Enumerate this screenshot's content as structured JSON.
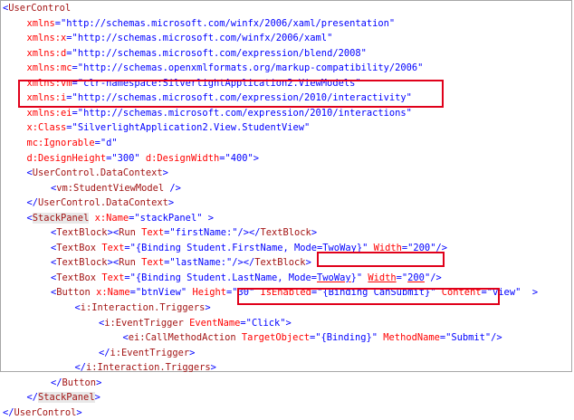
{
  "lines": [
    {
      "indent": 0,
      "segments": [
        {
          "c": "br",
          "t": "<"
        },
        {
          "c": "tag",
          "t": "UserControl"
        }
      ]
    },
    {
      "indent": 1,
      "segments": [
        {
          "c": "attr",
          "t": "xmlns"
        },
        {
          "c": "br",
          "t": "=\""
        },
        {
          "c": "val",
          "t": "http://schemas.microsoft.com/winfx/2006/xaml/presentation"
        },
        {
          "c": "br",
          "t": "\""
        }
      ]
    },
    {
      "indent": 1,
      "segments": [
        {
          "c": "attr",
          "t": "xmlns:x"
        },
        {
          "c": "br",
          "t": "=\""
        },
        {
          "c": "val",
          "t": "http://schemas.microsoft.com/winfx/2006/xaml"
        },
        {
          "c": "br",
          "t": "\""
        }
      ]
    },
    {
      "indent": 1,
      "segments": [
        {
          "c": "attr",
          "t": "xmlns:d"
        },
        {
          "c": "br",
          "t": "=\""
        },
        {
          "c": "val",
          "t": "http://schemas.microsoft.com/expression/blend/2008"
        },
        {
          "c": "br",
          "t": "\""
        }
      ]
    },
    {
      "indent": 1,
      "segments": [
        {
          "c": "attr",
          "t": "xmlns:mc"
        },
        {
          "c": "br",
          "t": "=\""
        },
        {
          "c": "val",
          "t": "http://schemas.openxmlformats.org/markup-compatibility/2006"
        },
        {
          "c": "br",
          "t": "\""
        }
      ]
    },
    {
      "indent": 1,
      "segments": [
        {
          "c": "attr",
          "t": "xmlns:vm"
        },
        {
          "c": "br",
          "t": "=\""
        },
        {
          "c": "val",
          "t": "clr-namespace:SilverlightApplication2.ViewModels"
        },
        {
          "c": "br",
          "t": "\""
        }
      ]
    },
    {
      "indent": 1,
      "segments": [
        {
          "c": "attr",
          "t": "xmlns:i"
        },
        {
          "c": "br",
          "t": "=\""
        },
        {
          "c": "val",
          "t": "http://schemas.microsoft.com/expression/2010/interactivity"
        },
        {
          "c": "br",
          "t": "\""
        }
      ]
    },
    {
      "indent": 1,
      "segments": [
        {
          "c": "attr",
          "t": "xmlns:ei"
        },
        {
          "c": "br",
          "t": "=\""
        },
        {
          "c": "val",
          "t": "http://schemas.microsoft.com/expression/2010/interactions"
        },
        {
          "c": "br",
          "t": "\""
        }
      ]
    },
    {
      "indent": 1,
      "segments": [
        {
          "c": "attr",
          "t": "x:Class"
        },
        {
          "c": "br",
          "t": "=\""
        },
        {
          "c": "val",
          "t": "SilverlightApplication2.View.StudentView"
        },
        {
          "c": "br",
          "t": "\""
        }
      ]
    },
    {
      "indent": 1,
      "segments": [
        {
          "c": "attr",
          "t": "mc:Ignorable"
        },
        {
          "c": "br",
          "t": "=\""
        },
        {
          "c": "val",
          "t": "d"
        },
        {
          "c": "br",
          "t": "\""
        }
      ]
    },
    {
      "indent": 1,
      "segments": [
        {
          "c": "attr",
          "t": "d:DesignHeight"
        },
        {
          "c": "br",
          "t": "=\""
        },
        {
          "c": "val",
          "t": "300"
        },
        {
          "c": "br",
          "t": "\" "
        },
        {
          "c": "attr",
          "t": "d:DesignWidth"
        },
        {
          "c": "br",
          "t": "=\""
        },
        {
          "c": "val",
          "t": "400"
        },
        {
          "c": "br",
          "t": "\">"
        }
      ]
    },
    {
      "indent": 1,
      "segments": [
        {
          "c": "br",
          "t": "<"
        },
        {
          "c": "tag",
          "t": "UserControl.DataContext"
        },
        {
          "c": "br",
          "t": ">"
        }
      ]
    },
    {
      "indent": 2,
      "segments": [
        {
          "c": "br",
          "t": "<"
        },
        {
          "c": "tag",
          "t": "vm:StudentViewModel"
        },
        {
          "c": "br",
          "t": " />"
        }
      ]
    },
    {
      "indent": 1,
      "segments": [
        {
          "c": "br",
          "t": "</"
        },
        {
          "c": "tag",
          "t": "UserControl.DataContext"
        },
        {
          "c": "br",
          "t": ">"
        }
      ]
    },
    {
      "indent": 1,
      "segments": [
        {
          "c": "br",
          "t": "<"
        },
        {
          "c": "tag hl-bg",
          "t": "StackPanel"
        },
        {
          "c": "attr",
          "t": " x:Name"
        },
        {
          "c": "br",
          "t": "=\""
        },
        {
          "c": "val",
          "t": "stackPanel"
        },
        {
          "c": "br",
          "t": "\" >"
        }
      ]
    },
    {
      "indent": 2,
      "segments": [
        {
          "c": "br",
          "t": "<"
        },
        {
          "c": "tag",
          "t": "TextBlock"
        },
        {
          "c": "br",
          "t": "><"
        },
        {
          "c": "tag",
          "t": "Run"
        },
        {
          "c": "attr",
          "t": " Text"
        },
        {
          "c": "br",
          "t": "=\""
        },
        {
          "c": "val",
          "t": "firstName:"
        },
        {
          "c": "br",
          "t": "\"/></"
        },
        {
          "c": "tag",
          "t": "TextBlock"
        },
        {
          "c": "br",
          "t": ">"
        }
      ]
    },
    {
      "indent": 2,
      "segments": [
        {
          "c": "br",
          "t": "<"
        },
        {
          "c": "tag",
          "t": "TextBox"
        },
        {
          "c": "attr",
          "t": " Text"
        },
        {
          "c": "br",
          "t": "=\""
        },
        {
          "c": "val",
          "t": "{Binding Student.FirstName, Mode=TwoWay}"
        },
        {
          "c": "br",
          "t": "\" "
        },
        {
          "c": "attr",
          "t": "Width"
        },
        {
          "c": "br",
          "t": "=\""
        },
        {
          "c": "val",
          "t": "200"
        },
        {
          "c": "br",
          "t": "\"/>"
        }
      ]
    },
    {
      "indent": 2,
      "segments": [
        {
          "c": "br",
          "t": "<"
        },
        {
          "c": "tag",
          "t": "TextBlock"
        },
        {
          "c": "br",
          "t": "><"
        },
        {
          "c": "tag",
          "t": "Run"
        },
        {
          "c": "attr",
          "t": " Text"
        },
        {
          "c": "br",
          "t": "=\""
        },
        {
          "c": "val",
          "t": "lastName:"
        },
        {
          "c": "br",
          "t": "\"/></"
        },
        {
          "c": "tag",
          "t": "TextBlock"
        },
        {
          "c": "br",
          "t": ">"
        }
      ]
    },
    {
      "indent": 2,
      "segments": [
        {
          "c": "br",
          "t": "<"
        },
        {
          "c": "tag",
          "t": "TextBox"
        },
        {
          "c": "attr",
          "t": " Text"
        },
        {
          "c": "br",
          "t": "=\""
        },
        {
          "c": "val",
          "t": "{Binding Student.LastName, Mode="
        },
        {
          "c": "val underline-red",
          "t": "TwoWay"
        },
        {
          "c": "val",
          "t": "}"
        },
        {
          "c": "br",
          "t": "\" "
        },
        {
          "c": "attr underline-red",
          "t": "Width"
        },
        {
          "c": "br",
          "t": "=\""
        },
        {
          "c": "val underline-red",
          "t": "200"
        },
        {
          "c": "br",
          "t": "\"/>"
        }
      ]
    },
    {
      "indent": 2,
      "segments": [
        {
          "c": "br",
          "t": "<"
        },
        {
          "c": "tag",
          "t": "Button"
        },
        {
          "c": "attr",
          "t": " x:Name"
        },
        {
          "c": "br",
          "t": "=\""
        },
        {
          "c": "val",
          "t": "btnView"
        },
        {
          "c": "br",
          "t": "\" "
        },
        {
          "c": "attr",
          "t": "Height"
        },
        {
          "c": "br",
          "t": "=\""
        },
        {
          "c": "val",
          "t": "30"
        },
        {
          "c": "br",
          "t": "\" "
        },
        {
          "c": "attr",
          "t": "IsEnabled"
        },
        {
          "c": "br",
          "t": "=\""
        },
        {
          "c": "val",
          "t": "{Binding CanSubmit}"
        },
        {
          "c": "br",
          "t": "\" "
        },
        {
          "c": "attr",
          "t": "Content"
        },
        {
          "c": "br",
          "t": "=\""
        },
        {
          "c": "val",
          "t": "view"
        },
        {
          "c": "br",
          "t": "\"  >"
        }
      ]
    },
    {
      "indent": 3,
      "segments": [
        {
          "c": "br",
          "t": "<"
        },
        {
          "c": "tag",
          "t": "i:Interaction.Triggers"
        },
        {
          "c": "br",
          "t": ">"
        }
      ]
    },
    {
      "indent": 4,
      "segments": [
        {
          "c": "br",
          "t": "<"
        },
        {
          "c": "tag",
          "t": "i:EventTrigger"
        },
        {
          "c": "attr",
          "t": " EventName"
        },
        {
          "c": "br",
          "t": "=\""
        },
        {
          "c": "val",
          "t": "Click"
        },
        {
          "c": "br",
          "t": "\">"
        }
      ]
    },
    {
      "indent": 5,
      "segments": [
        {
          "c": "br",
          "t": "<"
        },
        {
          "c": "tag",
          "t": "ei:CallMethodAction"
        },
        {
          "c": "attr",
          "t": " TargetObject"
        },
        {
          "c": "br",
          "t": "=\""
        },
        {
          "c": "val",
          "t": "{Binding}"
        },
        {
          "c": "br",
          "t": "\" "
        },
        {
          "c": "attr",
          "t": "MethodName"
        },
        {
          "c": "br",
          "t": "=\""
        },
        {
          "c": "val",
          "t": "Submit"
        },
        {
          "c": "br",
          "t": "\"/>"
        }
      ]
    },
    {
      "indent": 4,
      "segments": [
        {
          "c": "br",
          "t": "</"
        },
        {
          "c": "tag",
          "t": "i:EventTrigger"
        },
        {
          "c": "br",
          "t": ">"
        }
      ]
    },
    {
      "indent": 3,
      "segments": [
        {
          "c": "br",
          "t": "</"
        },
        {
          "c": "tag",
          "t": "i:Interaction.Triggers"
        },
        {
          "c": "br",
          "t": ">"
        }
      ]
    },
    {
      "indent": 2,
      "segments": [
        {
          "c": "br",
          "t": "</"
        },
        {
          "c": "tag",
          "t": "Button"
        },
        {
          "c": "br",
          "t": ">"
        }
      ]
    },
    {
      "indent": 1,
      "segments": [
        {
          "c": "br",
          "t": "</"
        },
        {
          "c": "tag hl-bg",
          "t": "StackPanel"
        },
        {
          "c": "br",
          "t": ">"
        }
      ]
    },
    {
      "indent": 0,
      "segments": [
        {
          "c": "br",
          "t": "</"
        },
        {
          "c": "tag",
          "t": "UserControl"
        },
        {
          "c": "br",
          "t": ">"
        }
      ]
    }
  ],
  "colors": {
    "tag": "#a31515",
    "attribute": "#ff0000",
    "value": "#0000ff",
    "highlight_box": "#e0001a"
  }
}
